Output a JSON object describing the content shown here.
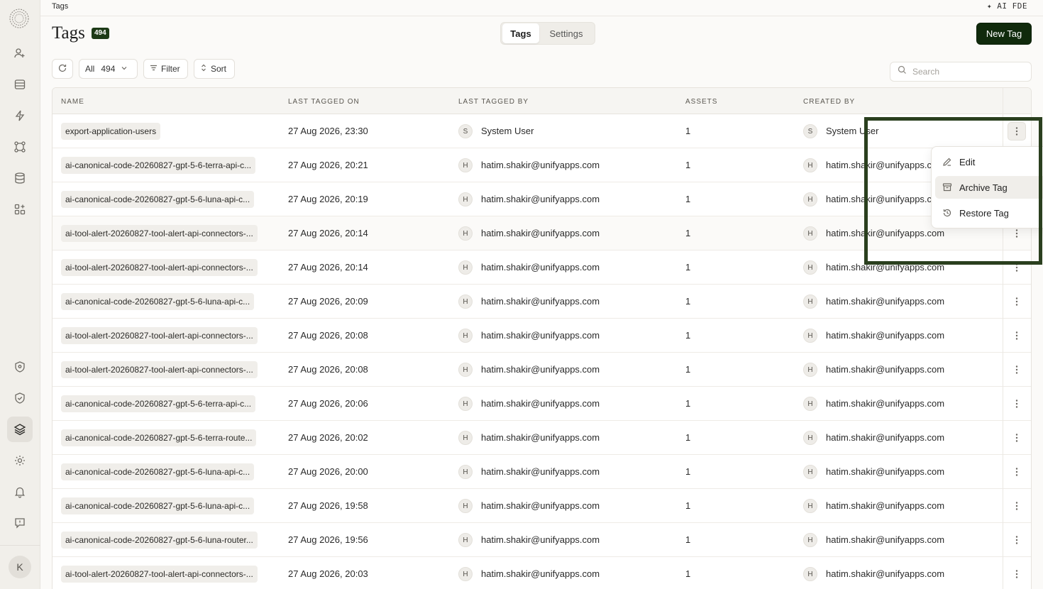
{
  "breadcrumb": "Tags",
  "ai_badge": "✦ AI FDE",
  "page": {
    "title": "Tags",
    "count": "494"
  },
  "tabs": [
    {
      "label": "Tags",
      "active": true
    },
    {
      "label": "Settings",
      "active": false
    }
  ],
  "new_tag_label": "New Tag",
  "toolbar": {
    "all_label": "All",
    "all_count": "494",
    "filter_label": "Filter",
    "sort_label": "Sort"
  },
  "search": {
    "placeholder": "Search"
  },
  "columns": [
    "NAME",
    "LAST TAGGED ON",
    "LAST TAGGED BY",
    "ASSETS",
    "CREATED BY"
  ],
  "rows": [
    {
      "name": "export-application-users",
      "last_tagged_on": "27 Aug 2026, 23:30",
      "tagged_by_initial": "S",
      "tagged_by": "System User",
      "assets": "1",
      "created_initial": "S",
      "created_by": "System User"
    },
    {
      "name": "ai-canonical-code-20260827-gpt-5-6-terra-api-c...",
      "last_tagged_on": "27 Aug 2026, 20:21",
      "tagged_by_initial": "H",
      "tagged_by": "hatim.shakir@unifyapps.com",
      "assets": "1",
      "created_initial": "H",
      "created_by": "hatim.shakir@unifyapps.com"
    },
    {
      "name": "ai-canonical-code-20260827-gpt-5-6-luna-api-c...",
      "last_tagged_on": "27 Aug 2026, 20:19",
      "tagged_by_initial": "H",
      "tagged_by": "hatim.shakir@unifyapps.com",
      "assets": "1",
      "created_initial": "H",
      "created_by": "hatim.shakir@unifyapps.com"
    },
    {
      "name": "ai-tool-alert-20260827-tool-alert-api-connectors-...",
      "last_tagged_on": "27 Aug 2026, 20:14",
      "tagged_by_initial": "H",
      "tagged_by": "hatim.shakir@unifyapps.com",
      "assets": "1",
      "created_initial": "H",
      "created_by": "hatim.shakir@unifyapps.com"
    },
    {
      "name": "ai-tool-alert-20260827-tool-alert-api-connectors-...",
      "last_tagged_on": "27 Aug 2026, 20:14",
      "tagged_by_initial": "H",
      "tagged_by": "hatim.shakir@unifyapps.com",
      "assets": "1",
      "created_initial": "H",
      "created_by": "hatim.shakir@unifyapps.com"
    },
    {
      "name": "ai-canonical-code-20260827-gpt-5-6-luna-api-c...",
      "last_tagged_on": "27 Aug 2026, 20:09",
      "tagged_by_initial": "H",
      "tagged_by": "hatim.shakir@unifyapps.com",
      "assets": "1",
      "created_initial": "H",
      "created_by": "hatim.shakir@unifyapps.com"
    },
    {
      "name": "ai-tool-alert-20260827-tool-alert-api-connectors-...",
      "last_tagged_on": "27 Aug 2026, 20:08",
      "tagged_by_initial": "H",
      "tagged_by": "hatim.shakir@unifyapps.com",
      "assets": "1",
      "created_initial": "H",
      "created_by": "hatim.shakir@unifyapps.com"
    },
    {
      "name": "ai-tool-alert-20260827-tool-alert-api-connectors-...",
      "last_tagged_on": "27 Aug 2026, 20:08",
      "tagged_by_initial": "H",
      "tagged_by": "hatim.shakir@unifyapps.com",
      "assets": "1",
      "created_initial": "H",
      "created_by": "hatim.shakir@unifyapps.com"
    },
    {
      "name": "ai-canonical-code-20260827-gpt-5-6-terra-api-c...",
      "last_tagged_on": "27 Aug 2026, 20:06",
      "tagged_by_initial": "H",
      "tagged_by": "hatim.shakir@unifyapps.com",
      "assets": "1",
      "created_initial": "H",
      "created_by": "hatim.shakir@unifyapps.com"
    },
    {
      "name": "ai-canonical-code-20260827-gpt-5-6-terra-route...",
      "last_tagged_on": "27 Aug 2026, 20:02",
      "tagged_by_initial": "H",
      "tagged_by": "hatim.shakir@unifyapps.com",
      "assets": "1",
      "created_initial": "H",
      "created_by": "hatim.shakir@unifyapps.com"
    },
    {
      "name": "ai-canonical-code-20260827-gpt-5-6-luna-api-c...",
      "last_tagged_on": "27 Aug 2026, 20:00",
      "tagged_by_initial": "H",
      "tagged_by": "hatim.shakir@unifyapps.com",
      "assets": "1",
      "created_initial": "H",
      "created_by": "hatim.shakir@unifyapps.com"
    },
    {
      "name": "ai-canonical-code-20260827-gpt-5-6-luna-api-c...",
      "last_tagged_on": "27 Aug 2026, 19:58",
      "tagged_by_initial": "H",
      "tagged_by": "hatim.shakir@unifyapps.com",
      "assets": "1",
      "created_initial": "H",
      "created_by": "hatim.shakir@unifyapps.com"
    },
    {
      "name": "ai-canonical-code-20260827-gpt-5-6-luna-router...",
      "last_tagged_on": "27 Aug 2026, 19:56",
      "tagged_by_initial": "H",
      "tagged_by": "hatim.shakir@unifyapps.com",
      "assets": "1",
      "created_initial": "H",
      "created_by": "hatim.shakir@unifyapps.com"
    },
    {
      "name": "ai-tool-alert-20260827-tool-alert-api-connectors-...",
      "last_tagged_on": "27 Aug 2026, 20:03",
      "tagged_by_initial": "H",
      "tagged_by": "hatim.shakir@unifyapps.com",
      "assets": "1",
      "created_initial": "H",
      "created_by": "hatim.shakir@unifyapps.com"
    }
  ],
  "row_menu": {
    "items": [
      {
        "label": "Edit",
        "icon": "pencil-icon"
      },
      {
        "label": "Archive Tag",
        "icon": "archive-icon"
      },
      {
        "label": "Restore Tag",
        "icon": "restore-icon"
      }
    ]
  },
  "user_avatar_initial": "K",
  "highlight_color": "#2a3f1e",
  "accent_color": "#102a0c"
}
